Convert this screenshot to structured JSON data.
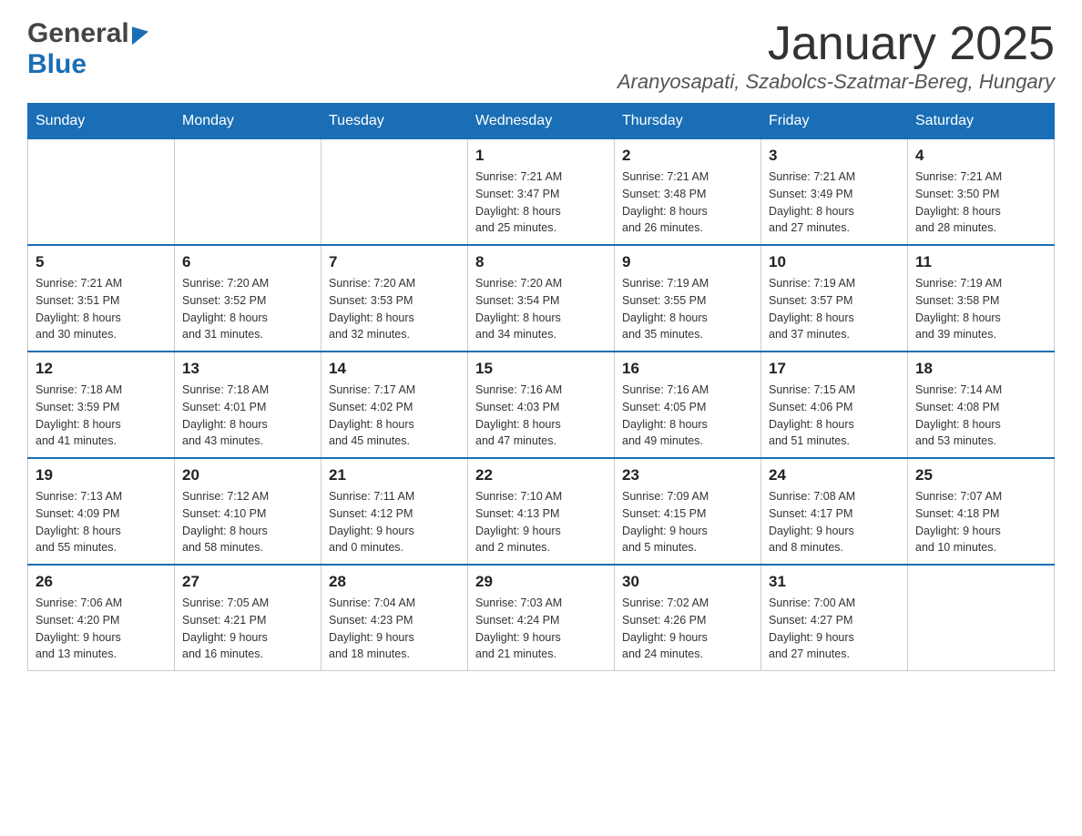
{
  "header": {
    "logo_general": "General",
    "logo_blue": "Blue",
    "month_title": "January 2025",
    "location": "Aranyosapati, Szabolcs-Szatmar-Bereg, Hungary"
  },
  "weekdays": [
    "Sunday",
    "Monday",
    "Tuesday",
    "Wednesday",
    "Thursday",
    "Friday",
    "Saturday"
  ],
  "weeks": [
    [
      {
        "day": "",
        "info": ""
      },
      {
        "day": "",
        "info": ""
      },
      {
        "day": "",
        "info": ""
      },
      {
        "day": "1",
        "info": "Sunrise: 7:21 AM\nSunset: 3:47 PM\nDaylight: 8 hours\nand 25 minutes."
      },
      {
        "day": "2",
        "info": "Sunrise: 7:21 AM\nSunset: 3:48 PM\nDaylight: 8 hours\nand 26 minutes."
      },
      {
        "day": "3",
        "info": "Sunrise: 7:21 AM\nSunset: 3:49 PM\nDaylight: 8 hours\nand 27 minutes."
      },
      {
        "day": "4",
        "info": "Sunrise: 7:21 AM\nSunset: 3:50 PM\nDaylight: 8 hours\nand 28 minutes."
      }
    ],
    [
      {
        "day": "5",
        "info": "Sunrise: 7:21 AM\nSunset: 3:51 PM\nDaylight: 8 hours\nand 30 minutes."
      },
      {
        "day": "6",
        "info": "Sunrise: 7:20 AM\nSunset: 3:52 PM\nDaylight: 8 hours\nand 31 minutes."
      },
      {
        "day": "7",
        "info": "Sunrise: 7:20 AM\nSunset: 3:53 PM\nDaylight: 8 hours\nand 32 minutes."
      },
      {
        "day": "8",
        "info": "Sunrise: 7:20 AM\nSunset: 3:54 PM\nDaylight: 8 hours\nand 34 minutes."
      },
      {
        "day": "9",
        "info": "Sunrise: 7:19 AM\nSunset: 3:55 PM\nDaylight: 8 hours\nand 35 minutes."
      },
      {
        "day": "10",
        "info": "Sunrise: 7:19 AM\nSunset: 3:57 PM\nDaylight: 8 hours\nand 37 minutes."
      },
      {
        "day": "11",
        "info": "Sunrise: 7:19 AM\nSunset: 3:58 PM\nDaylight: 8 hours\nand 39 minutes."
      }
    ],
    [
      {
        "day": "12",
        "info": "Sunrise: 7:18 AM\nSunset: 3:59 PM\nDaylight: 8 hours\nand 41 minutes."
      },
      {
        "day": "13",
        "info": "Sunrise: 7:18 AM\nSunset: 4:01 PM\nDaylight: 8 hours\nand 43 minutes."
      },
      {
        "day": "14",
        "info": "Sunrise: 7:17 AM\nSunset: 4:02 PM\nDaylight: 8 hours\nand 45 minutes."
      },
      {
        "day": "15",
        "info": "Sunrise: 7:16 AM\nSunset: 4:03 PM\nDaylight: 8 hours\nand 47 minutes."
      },
      {
        "day": "16",
        "info": "Sunrise: 7:16 AM\nSunset: 4:05 PM\nDaylight: 8 hours\nand 49 minutes."
      },
      {
        "day": "17",
        "info": "Sunrise: 7:15 AM\nSunset: 4:06 PM\nDaylight: 8 hours\nand 51 minutes."
      },
      {
        "day": "18",
        "info": "Sunrise: 7:14 AM\nSunset: 4:08 PM\nDaylight: 8 hours\nand 53 minutes."
      }
    ],
    [
      {
        "day": "19",
        "info": "Sunrise: 7:13 AM\nSunset: 4:09 PM\nDaylight: 8 hours\nand 55 minutes."
      },
      {
        "day": "20",
        "info": "Sunrise: 7:12 AM\nSunset: 4:10 PM\nDaylight: 8 hours\nand 58 minutes."
      },
      {
        "day": "21",
        "info": "Sunrise: 7:11 AM\nSunset: 4:12 PM\nDaylight: 9 hours\nand 0 minutes."
      },
      {
        "day": "22",
        "info": "Sunrise: 7:10 AM\nSunset: 4:13 PM\nDaylight: 9 hours\nand 2 minutes."
      },
      {
        "day": "23",
        "info": "Sunrise: 7:09 AM\nSunset: 4:15 PM\nDaylight: 9 hours\nand 5 minutes."
      },
      {
        "day": "24",
        "info": "Sunrise: 7:08 AM\nSunset: 4:17 PM\nDaylight: 9 hours\nand 8 minutes."
      },
      {
        "day": "25",
        "info": "Sunrise: 7:07 AM\nSunset: 4:18 PM\nDaylight: 9 hours\nand 10 minutes."
      }
    ],
    [
      {
        "day": "26",
        "info": "Sunrise: 7:06 AM\nSunset: 4:20 PM\nDaylight: 9 hours\nand 13 minutes."
      },
      {
        "day": "27",
        "info": "Sunrise: 7:05 AM\nSunset: 4:21 PM\nDaylight: 9 hours\nand 16 minutes."
      },
      {
        "day": "28",
        "info": "Sunrise: 7:04 AM\nSunset: 4:23 PM\nDaylight: 9 hours\nand 18 minutes."
      },
      {
        "day": "29",
        "info": "Sunrise: 7:03 AM\nSunset: 4:24 PM\nDaylight: 9 hours\nand 21 minutes."
      },
      {
        "day": "30",
        "info": "Sunrise: 7:02 AM\nSunset: 4:26 PM\nDaylight: 9 hours\nand 24 minutes."
      },
      {
        "day": "31",
        "info": "Sunrise: 7:00 AM\nSunset: 4:27 PM\nDaylight: 9 hours\nand 27 minutes."
      },
      {
        "day": "",
        "info": ""
      }
    ]
  ]
}
